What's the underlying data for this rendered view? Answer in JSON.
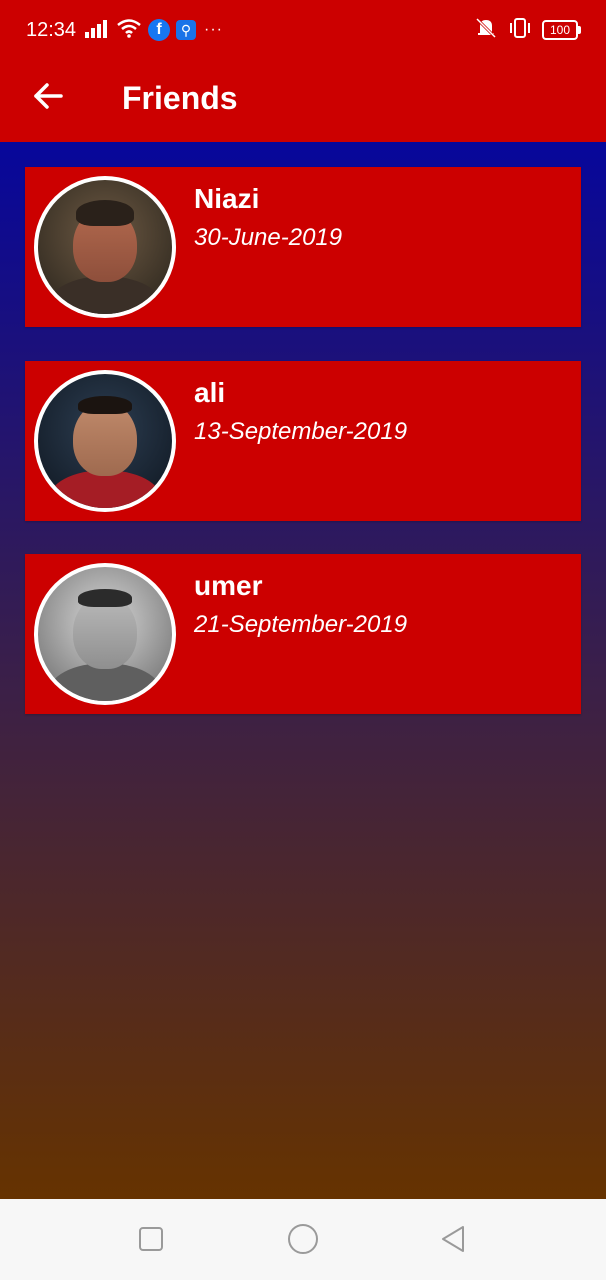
{
  "status_bar": {
    "time": "12:34",
    "battery": "100",
    "overflow": "···"
  },
  "app_bar": {
    "title": "Friends",
    "back_icon": "arrow-left-icon"
  },
  "friends": [
    {
      "name": "Niazi",
      "date": "30-June-2019",
      "avatar": "avatar-photo"
    },
    {
      "name": "ali",
      "date": "13-September-2019",
      "avatar": "avatar-photo"
    },
    {
      "name": "umer",
      "date": "21-September-2019",
      "avatar": "avatar-photo"
    }
  ],
  "nav_bar": {
    "recents_icon": "square-icon",
    "home_icon": "circle-icon",
    "back_icon": "triangle-back-icon"
  },
  "colors": {
    "primary": "#cc0000",
    "gradient_top": "#07079b",
    "gradient_bottom": "#663300"
  }
}
